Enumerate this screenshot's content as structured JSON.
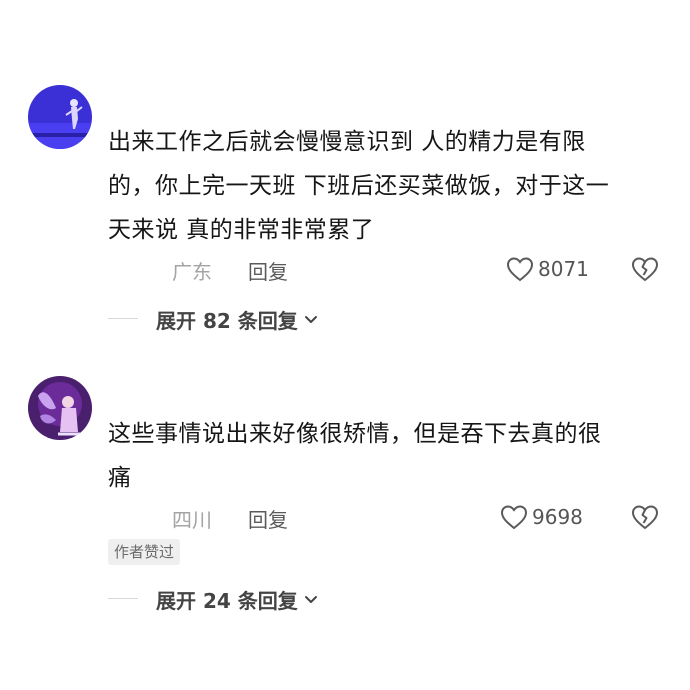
{
  "comments": [
    {
      "text_lines": [
        "出来工作之后就会慢慢意识到 人的精力是有限",
        "的，你上完一天班 下班后还买菜做饭，对于这一",
        "天来说 真的非常非常累了"
      ],
      "location": "广东",
      "reply_label": "回复",
      "likes": "8071",
      "expand_label": "展开 82 条回复",
      "avatar_icon": "avatar-blue-figure"
    },
    {
      "text_lines": [
        "这些事情说出来好像很矫情，但是吞下去真的很",
        "痛"
      ],
      "location": "四川",
      "reply_label": "回复",
      "likes": "9698",
      "author_badge": "作者赞过",
      "expand_label": "展开 24 条回复",
      "avatar_icon": "avatar-purple-figure"
    }
  ],
  "icons": {
    "like": "heart-outline-icon",
    "dislike": "broken-heart-icon",
    "expand": "chevron-down-icon"
  },
  "colors": {
    "background": "#ffffff",
    "text": "#161616",
    "muted": "#a4a4a4",
    "secondary": "#5a5a5a",
    "badge_bg": "#efefef"
  }
}
